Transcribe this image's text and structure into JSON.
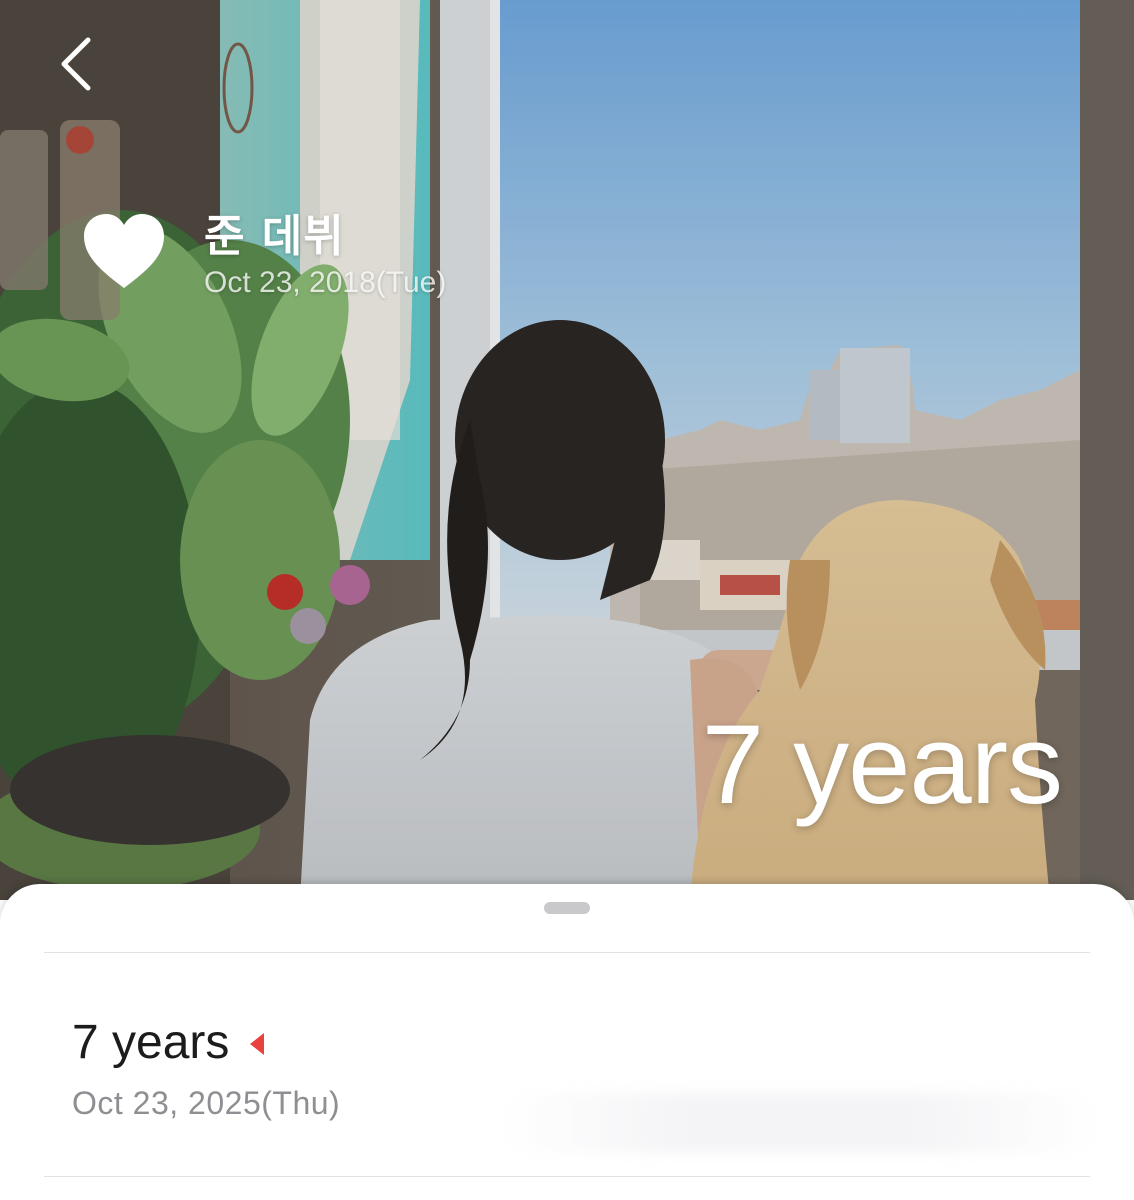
{
  "header": {
    "back_icon": "chevron-left-icon",
    "heart_icon": "heart-icon",
    "title": "준 데뷔",
    "start_date": "Oct 23, 2018(Tue)",
    "counter": "7 years"
  },
  "sheet": {
    "milestone": {
      "label": "7 years",
      "date": "Oct 23, 2025(Thu)",
      "marker_icon": "triangle-left-icon",
      "marker_color": "#e8413f"
    }
  },
  "colors": {
    "sky": "#7fb0e0",
    "heading_text": "#ffffff",
    "date_text_muted": "#8e8e93"
  }
}
